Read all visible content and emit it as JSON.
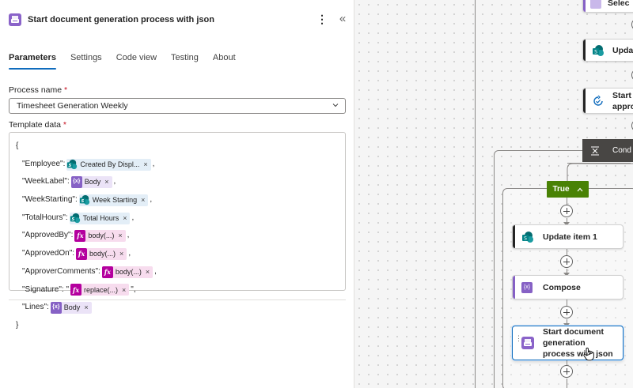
{
  "panel": {
    "title": "Start document generation process with json",
    "more_glyph": "⋮",
    "collapse_glyph": "«",
    "tabs": [
      {
        "label": "Parameters",
        "active": true
      },
      {
        "label": "Settings",
        "active": false
      },
      {
        "label": "Code view",
        "active": false
      },
      {
        "label": "Testing",
        "active": false
      },
      {
        "label": "About",
        "active": false
      }
    ],
    "process_name": {
      "label": "Process name",
      "required_mark": "*",
      "value": "Timesheet Generation Weekly"
    },
    "template_data": {
      "label": "Template data",
      "required_mark": "*",
      "open_brace": "{",
      "close_brace": "}",
      "rows": [
        {
          "key": "\"Employee\":",
          "token_type": "sp",
          "token_label": "Created By Displ...",
          "suffix": ","
        },
        {
          "key": "\"WeekLabel\":",
          "token_type": "var",
          "token_label": "Body",
          "suffix": ","
        },
        {
          "key": "\"WeekStarting\":",
          "token_type": "sp",
          "token_label": "Week Starting",
          "suffix": ","
        },
        {
          "key": "\"TotalHours\":",
          "token_type": "sp",
          "token_label": "Total Hours",
          "suffix": ","
        },
        {
          "key": "\"ApprovedBy\":",
          "token_type": "fx",
          "token_label": "body(...)",
          "suffix": ","
        },
        {
          "key": "\"ApprovedOn\":",
          "token_type": "fx",
          "token_label": "body(...)",
          "suffix": ","
        },
        {
          "key": "\"ApproverComments\":",
          "token_type": "fx",
          "token_label": "body(...)",
          "suffix": ","
        },
        {
          "key": "\"Signature\": \"",
          "token_type": "fx",
          "token_label": "replace(...)",
          "suffix": "\","
        },
        {
          "key": "\"Lines\":",
          "token_type": "var",
          "token_label": "Body",
          "suffix": ""
        }
      ],
      "token_remove_glyph": "×",
      "var_icon_text": "{x}",
      "fx_icon_text": "fx"
    }
  },
  "canvas": {
    "nodes": {
      "select_partial": "Selec",
      "update_partial": "Upda",
      "start_partial_line1": "Start",
      "start_partial_line2": "appro",
      "condition_partial": "Cond",
      "true_label": "True",
      "true_chevron": "^",
      "update_item": "Update item 1",
      "compose": "Compose",
      "start_doc": "Start document generation process with json"
    }
  },
  "colors": {
    "accent": "#0f6cbd",
    "true_branch": "#498205",
    "doc_gen_action": "#8a63c9",
    "condition_node": "#484644",
    "sharepoint": "#036c70"
  }
}
